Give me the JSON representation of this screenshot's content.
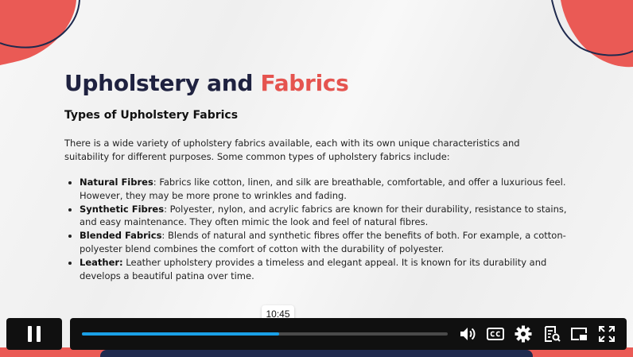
{
  "slide": {
    "title_main": "Upholstery and",
    "title_accent": "Fabrics",
    "subtitle": "Types of Upholstery Fabrics",
    "intro": "There is a wide variety of upholstery fabrics available, each with its own unique characteristics and suitability for different purposes. Some common types of upholstery fabrics include:",
    "items": [
      {
        "term": "Natural Fibres",
        "sep": ":",
        "text": " Fabrics like cotton, linen, and silk are breathable, comfortable, and offer a luxurious feel. However, they may be more prone to wrinkles and fading."
      },
      {
        "term": "Synthetic Fibres",
        "sep": ":",
        "text": " Polyester, nylon, and acrylic fabrics are known for their durability, resistance to stains, and easy maintenance. They often mimic the look and feel of natural fibres."
      },
      {
        "term": "Blended Fabrics",
        "sep": ":",
        "text": " Blends of natural and synthetic fibres offer the benefits of both. For example, a cotton-polyester blend combines the comfort of cotton with the durability of polyester."
      },
      {
        "term": "Leather:",
        "sep": "",
        "text": " Leather upholstery provides a timeless and elegant appeal. It is known for its durability and develops a beautiful patina over time."
      }
    ]
  },
  "player": {
    "timestamp": "10:45",
    "progress_percent": 54,
    "icons": [
      "pause-icon",
      "volume-icon",
      "captions-icon",
      "settings-icon",
      "transcript-icon",
      "picture-in-picture-icon",
      "fullscreen-icon"
    ]
  },
  "colors": {
    "title_dark": "#1f2240",
    "accent_red": "#e5544f",
    "progress_blue": "#1aa0e6",
    "player_bg": "#101010"
  }
}
